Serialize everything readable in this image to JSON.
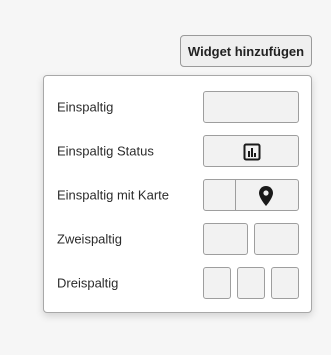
{
  "header": {
    "add_widget_label": "Widget hinzufügen"
  },
  "menu": {
    "items": [
      {
        "label": "Einspaltig",
        "preview": "single"
      },
      {
        "label": "Einspaltig Status",
        "preview": "single-status",
        "icon": "bar-chart-icon"
      },
      {
        "label": "Einspaltig mit Karte",
        "preview": "single-map",
        "icon": "map-pin-icon"
      },
      {
        "label": "Zweispaltig",
        "preview": "two-columns"
      },
      {
        "label": "Dreispaltig",
        "preview": "three-columns"
      }
    ]
  },
  "colors": {
    "box_fill": "#f2f2f2",
    "box_border": "#9e9e9e",
    "icon": "#1a1a1a"
  }
}
